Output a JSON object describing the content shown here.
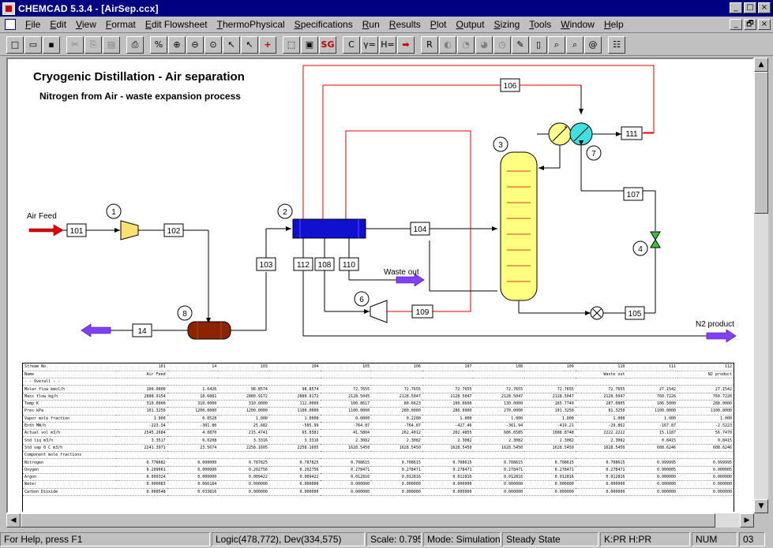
{
  "window": {
    "title": "CHEMCAD 5.3.4 - [AirSep.ccx]",
    "min": "_",
    "max": "□",
    "close": "×",
    "restore": "🗗"
  },
  "menu": [
    "File",
    "Edit",
    "View",
    "Format",
    "Edit Flowsheet",
    "ThermoPhysical",
    "Specifications",
    "Run",
    "Results",
    "Plot",
    "Output",
    "Sizing",
    "Tools",
    "Window",
    "Help"
  ],
  "toolbar": {
    "percent": "%",
    "sg": "SG",
    "gamma": "γ=",
    "h": "H=",
    "r": "R",
    "c": "C"
  },
  "flowsheet": {
    "title": "Cryogenic Distillation - Air separation",
    "subtitle": "Nitrogen from Air - waste expansion process",
    "air_feed": "Air Feed",
    "waste_out": "Waste out",
    "n2_product": "N2 product",
    "units": [
      "1",
      "2",
      "3",
      "4",
      "6",
      "7",
      "8"
    ],
    "streams": [
      "101",
      "102",
      "103",
      "104",
      "105",
      "106",
      "107",
      "108",
      "109",
      "110",
      "111",
      "112",
      "14"
    ]
  },
  "report": {
    "rows": [
      [
        "Stream No.",
        "101",
        "14",
        "103",
        "104",
        "105",
        "106",
        "107",
        "108",
        "109",
        "110",
        "111",
        "112"
      ],
      [
        "Name",
        "Air Feed",
        "",
        "",
        "",
        "",
        "",
        "",
        "",
        "",
        "Waste out",
        "",
        "N2 product"
      ],
      [
        "- - Overall - -",
        "",
        "",
        "",
        "",
        "",
        "",
        "",
        "",
        "",
        "",
        "",
        ""
      ],
      [
        "Molar flow kmol/h",
        "100.0000",
        "1.6426",
        "98.8574",
        "98.8574",
        "72.7655",
        "72.7655",
        "72.7655",
        "72.7655",
        "72.7655",
        "72.7655",
        "27.1542",
        "27.1542"
      ],
      [
        "Mass flow  kg/h",
        "2888.9154",
        "18.6881",
        "2880.9172",
        "2880.9172",
        "2128.5045",
        "2128.5047",
        "2128.5047",
        "2128.5047",
        "2128.5047",
        "2128.5047",
        "760.7226",
        "760.7226"
      ],
      [
        "Temp K",
        "310.0000",
        "310.0000",
        "310.0000",
        "112.0000",
        "100.8617",
        "80.6623",
        "100.0600",
        "130.0000",
        "165.7749",
        "287.0805",
        "106.5000",
        "288.0000"
      ],
      [
        "Pres kPa",
        "101.3250",
        "1200.0000",
        "1200.0000",
        "1100.0000",
        "1100.0000",
        "280.0000",
        "280.0000",
        "270.0000",
        "101.3250",
        "81.3250",
        "1100.0000",
        "1100.0000"
      ],
      [
        "Vapor mole fraction",
        "1.000",
        "0.0528",
        "1.000",
        "1.0000",
        "0.0000",
        "0.2280",
        "1.000",
        "1.000",
        "1.000",
        "1.000",
        "1.000",
        "1.000"
      ],
      [
        "Enth MW/h",
        "-223.54",
        "-301.80",
        "25.682",
        "-585.99",
        "-764.87",
        "-764.87",
        "-427.46",
        "-361.94",
        "-419.21",
        "-29.862",
        "-167.87",
        "-2.5223"
      ],
      [
        "Actual vol m3/h",
        "2545.2684",
        "4.0870",
        "215.4741",
        "65.0381",
        "41.5804",
        "262.4012",
        "202.4855",
        "686.6585",
        "1088.8748",
        "2222.2222",
        "15.1187",
        "56.7470"
      ],
      [
        "Std liq  m3/h",
        "3.3517",
        "0.0208",
        "3.3316",
        "3.3316",
        "2.3082",
        "2.3082",
        "2.3082",
        "2.3082",
        "2.3082",
        "2.3082",
        "0.8415",
        "0.8415"
      ],
      [
        "Std vap 0 C m3/h",
        "2241.3971",
        "23.5674",
        "2258.1605",
        "2258.1605",
        "1628.5450",
        "1628.5450",
        "1628.5450",
        "1628.5450",
        "1628.5450",
        "1628.5450",
        "608.6246",
        "608.6246"
      ],
      [
        "Component mole fractions",
        "",
        "",
        "",
        "",
        "",
        "",
        "",
        "",
        "",
        "",
        "",
        ""
      ],
      [
        "Nitrogen",
        "0.778682",
        "0.000000",
        "0.787825",
        "0.787825",
        "0.708615",
        "0.708615",
        "0.708615",
        "0.708615",
        "0.708615",
        "0.708615",
        "0.999995",
        "0.999995"
      ],
      [
        "Oxygen",
        "0.209661",
        "0.000000",
        "0.202756",
        "0.202756",
        "0.278471",
        "0.278471",
        "0.278471",
        "0.278471",
        "0.278471",
        "0.278471",
        "0.000005",
        "0.000005"
      ],
      [
        "Argon",
        "0.009324",
        "0.000000",
        "0.009422",
        "0.009422",
        "0.012816",
        "0.012816",
        "0.012816",
        "0.012816",
        "0.012816",
        "0.012816",
        "0.000000",
        "0.000000"
      ],
      [
        "Water",
        "0.000083",
        "0.066184",
        "0.000000",
        "0.000000",
        "0.000000",
        "0.000000",
        "0.000000",
        "0.000000",
        "0.000000",
        "0.000000",
        "0.000000",
        "0.000000"
      ],
      [
        "Carbon Dioxide",
        "0.000548",
        "0.033816",
        "0.000000",
        "0.000000",
        "0.000000",
        "0.000000",
        "0.000000",
        "0.000000",
        "0.000000",
        "0.000000",
        "0.000000",
        "0.000000"
      ]
    ]
  },
  "status": {
    "help": "For Help, press F1",
    "logic": "Logic(478,772), Dev(334,575)",
    "scale": "Scale: 0.795",
    "mode": "Mode: Simulation",
    "state": "Steady State",
    "thermo": "K:PR H:PR",
    "num": "NUM",
    "extra": "03"
  },
  "colors": {
    "titlebar": "#000080",
    "feed_arrow": "#e00000",
    "product_arrow": "#8040ff",
    "column": "#ffff80",
    "heat_exchanger": "#1010d0",
    "flash": "#8b2500",
    "condenser": "#40e0e0",
    "red_line": "#e00000"
  }
}
